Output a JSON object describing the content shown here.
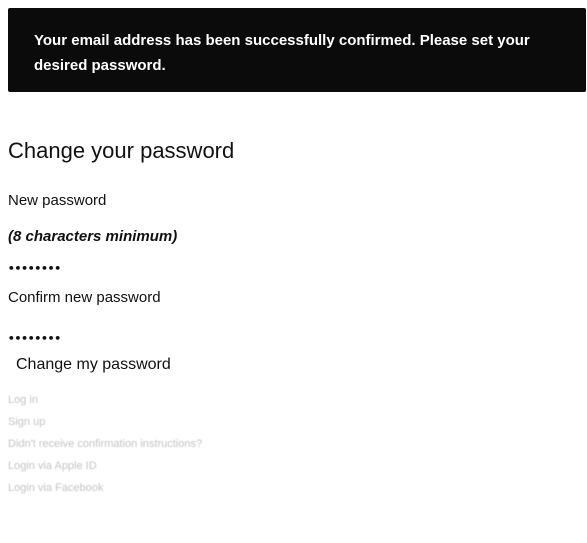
{
  "flash": {
    "message": "Your email address has been successfully confirmed. Please set your desired password."
  },
  "form": {
    "title": "Change your password",
    "new_password_label": "New password",
    "new_password_hint": "(8 characters minimum)",
    "new_password_value": "••••••••",
    "confirm_password_label": "Confirm new password",
    "confirm_password_value": "••••••••",
    "submit_label": "Change my password"
  },
  "footer_links": [
    {
      "label": "Log in"
    },
    {
      "label": "Sign up"
    },
    {
      "label": "Didn't receive confirmation instructions?"
    },
    {
      "label": "Login via Apple ID"
    },
    {
      "label": "Login via Facebook"
    }
  ]
}
